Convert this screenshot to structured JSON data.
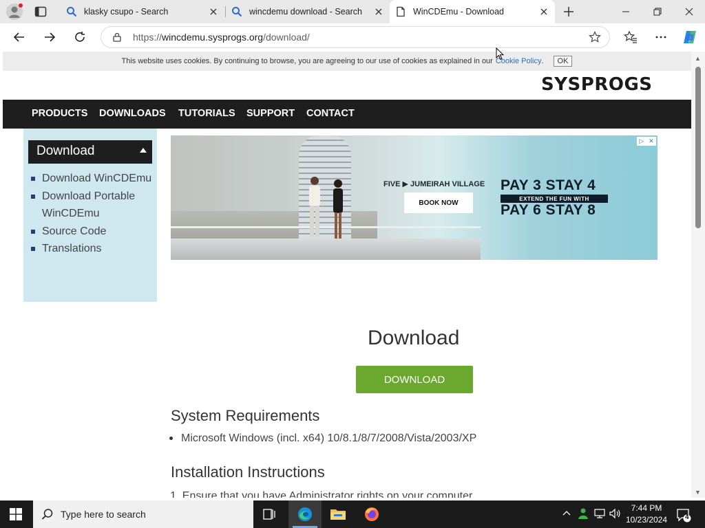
{
  "browser": {
    "tabs": [
      {
        "title": "klasky csupo - Search",
        "icon": "search-icon"
      },
      {
        "title": "wincdemu download - Search",
        "icon": "search-icon"
      },
      {
        "title": "WinCDEmu - Download",
        "icon": "page-icon"
      }
    ],
    "url_prefix": "https://",
    "url_host": "wincdemu.sysprogs.org",
    "url_path": "/download/"
  },
  "page": {
    "cookie": {
      "text": "This website uses cookies. By continuing to browse, you are agreeing to our use of cookies as explained in our",
      "link": "Cookie Policy",
      "after_link": ".",
      "ok": "OK"
    },
    "logo": "SYSPROGS",
    "menu": [
      "PRODUCTS",
      "DOWNLOADS",
      "TUTORIALS",
      "SUPPORT",
      "CONTACT"
    ],
    "sidebar": {
      "title": "Download",
      "items": [
        "Download WinCDEmu",
        "Download Portable WinCDEmu",
        "Source Code",
        "Translations"
      ]
    },
    "ad": {
      "brand": "FIVE ▶ JUMEIRAH VILLAGE",
      "cta": "BOOK NOW",
      "headline1": "PAY 3 STAY 4",
      "tagline": "EXTEND THE FUN WITH",
      "headline2": "PAY 6 STAY 8"
    },
    "heading": "Download",
    "download_button": "DOWNLOAD",
    "requirements_title": "System Requirements",
    "requirements": [
      "Microsoft Windows (incl. x64) 10/8.1/8/7/2008/Vista/2003/XP"
    ],
    "install_title": "Installation Instructions",
    "install_first": "1. Ensure that you have Administrator rights on your computer"
  },
  "taskbar": {
    "search_placeholder": "Type here to search",
    "time": "7:44 PM",
    "date": "10/23/2024",
    "notifications": "4"
  },
  "colors": {
    "menu_bg": "#1e1e1e",
    "sidebar_bg": "#cfe7ef",
    "download_button": "#6aa82f",
    "link": "#2a6fb0"
  }
}
